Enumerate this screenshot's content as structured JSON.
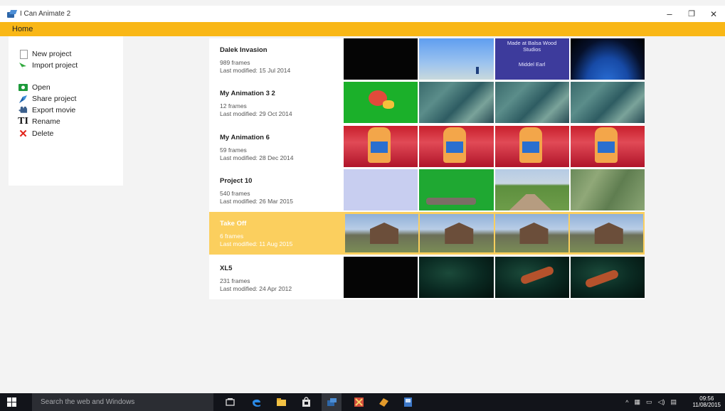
{
  "window": {
    "title": "I Can Animate 2",
    "controls": {
      "minimize": "–",
      "restore": "❐",
      "close": "✕"
    }
  },
  "ribbon": {
    "tab": "Home"
  },
  "menu": {
    "items": [
      {
        "label": "New project",
        "icon": "new-project-icon"
      },
      {
        "label": "Import project",
        "icon": "import-icon"
      },
      {
        "label": "Open",
        "icon": "open-icon"
      },
      {
        "label": "Share project",
        "icon": "share-icon"
      },
      {
        "label": "Export movie",
        "icon": "export-movie-icon"
      },
      {
        "label": "Rename",
        "icon": "rename-icon"
      },
      {
        "label": "Delete",
        "icon": "delete-icon"
      }
    ]
  },
  "projects": [
    {
      "name": "Dalek Invasion",
      "frames": "989 frames",
      "modified": "Last modified: 15 Jul 2014",
      "thumb_title": {
        "line1": "Made at Balsa Wood",
        "line2": "Studios",
        "line3": "Middel Earl"
      }
    },
    {
      "name": "My Animation 3 2",
      "frames": "12 frames",
      "modified": "Last modified: 29 Oct 2014"
    },
    {
      "name": "My Animation 6",
      "frames": "59 frames",
      "modified": "Last modified: 28 Dec 2014"
    },
    {
      "name": "Project 10",
      "frames": "540 frames",
      "modified": "Last modified: 26 Mar 2015"
    },
    {
      "name": "Take Off",
      "frames": "6 frames",
      "modified": "Last modified: 11 Aug 2015",
      "selected": true
    },
    {
      "name": "XL5",
      "frames": "231 frames",
      "modified": "Last modified: 24 Apr 2012"
    }
  ],
  "taskbar": {
    "search_placeholder": "Search the web and Windows",
    "time": "09:56",
    "date": "11/08/2015",
    "tray_icons": [
      "chevron-up-icon",
      "network-icon",
      "battery-icon",
      "volume-icon",
      "notification-icon"
    ]
  },
  "colors": {
    "ribbon": "#f9b716",
    "selected_row": "#fbcf5e",
    "taskbar": "#12141a",
    "delete": "#e2231a"
  }
}
